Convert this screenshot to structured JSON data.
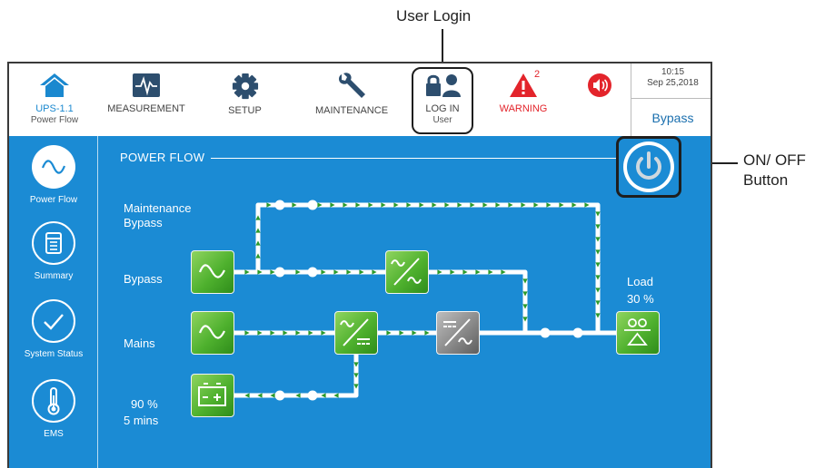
{
  "annotations": {
    "user_login": "User Login",
    "on_off_line1": "ON/ OFF",
    "on_off_line2": "Button"
  },
  "topbar": {
    "home": {
      "label": "UPS-1.1",
      "sub": "Power Flow"
    },
    "measurement": {
      "label": "MEASUREMENT"
    },
    "setup": {
      "label": "SETUP"
    },
    "maintenance": {
      "label": "MAINTENANCE"
    },
    "login": {
      "label": "LOG IN",
      "sub": "User"
    },
    "warning": {
      "label": "WARNING",
      "count": "2"
    },
    "clock": {
      "time": "10:15",
      "date": "Sep 25,2018"
    },
    "mode": "Bypass"
  },
  "sidebar": {
    "items": [
      {
        "label": "Power Flow",
        "icon": "sine-wave-icon"
      },
      {
        "label": "Summary",
        "icon": "summary-icon"
      },
      {
        "label": "System Status",
        "icon": "checkmark-icon"
      },
      {
        "label": "EMS",
        "icon": "thermometer-icon"
      }
    ]
  },
  "power_flow": {
    "title": "POWER FLOW",
    "labels": {
      "maintenance_bypass": "Maintenance Bypass",
      "bypass": "Bypass",
      "mains": "Mains",
      "load_title": "Load",
      "load_value": "30 %",
      "battery_percent": "90 %",
      "battery_time": "5 mins"
    }
  },
  "colors": {
    "background": "#1b8bd4",
    "module_green": "#4fb12e",
    "module_gray": "#8a8a8a",
    "accent_blue": "#1a88cf",
    "warning_red": "#e3242b",
    "flow_arrow": "#2a9a2a"
  }
}
